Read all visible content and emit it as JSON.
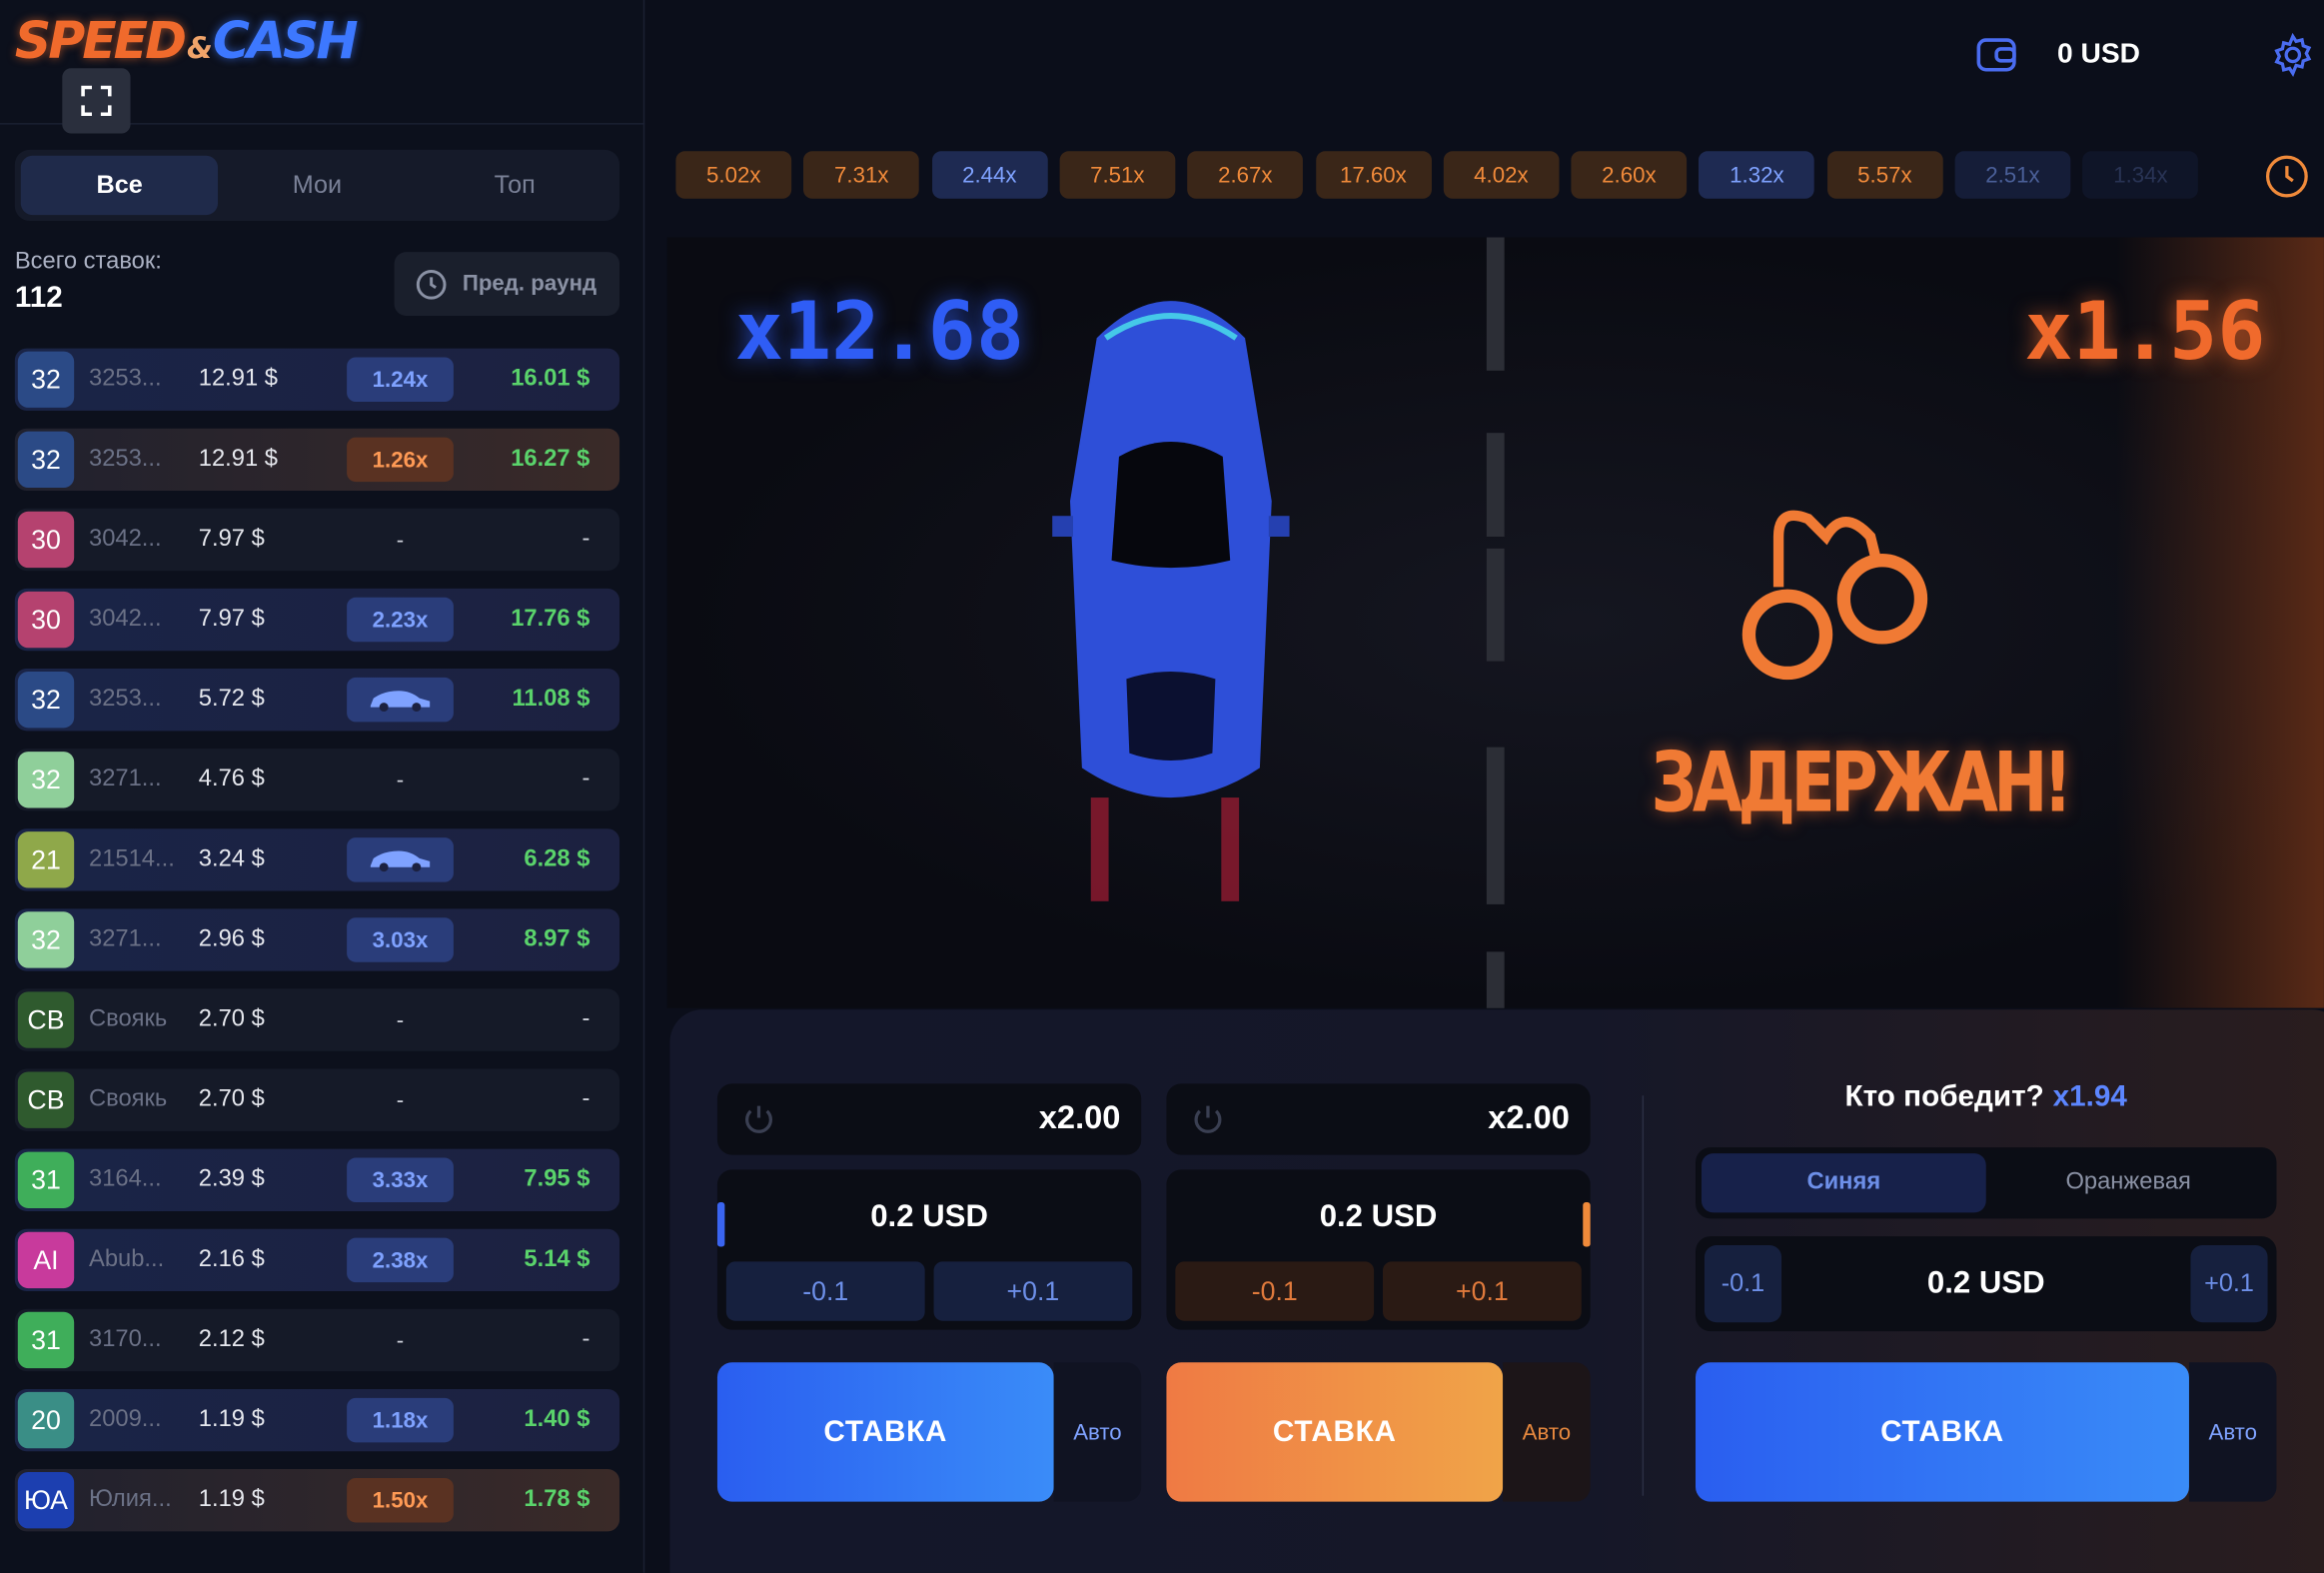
{
  "logo": {
    "part1": "SPEED",
    "amp": "&",
    "part2": "CASH"
  },
  "header": {
    "balance": "0 USD",
    "wallet_icon": "wallet-icon",
    "settings_icon": "gear-icon"
  },
  "sidebar": {
    "tabs": [
      {
        "label": "Все"
      },
      {
        "label": "Мои"
      },
      {
        "label": "Топ"
      }
    ],
    "total_label": "Всего ставок:",
    "total_value": "112",
    "prev_round_label": "Пред. раунд",
    "bets": [
      {
        "avatar": "32",
        "avatar_color": "#2b4a86",
        "name": "3253...",
        "amount": "12.91 $",
        "mult": "1.24x",
        "mult_style": "b",
        "payout": "16.01 $",
        "style": "blue"
      },
      {
        "avatar": "32",
        "avatar_color": "#2b4a86",
        "name": "3253...",
        "amount": "12.91 $",
        "mult": "1.26x",
        "mult_style": "o",
        "payout": "16.27 $",
        "style": "orange"
      },
      {
        "avatar": "30",
        "avatar_color": "#b5426f",
        "name": "3042...",
        "amount": "7.97 $",
        "mult": "-",
        "mult_style": "dash",
        "payout": "-",
        "style": "plain"
      },
      {
        "avatar": "30",
        "avatar_color": "#b5426f",
        "name": "3042...",
        "amount": "7.97 $",
        "mult": "2.23x",
        "mult_style": "b",
        "payout": "17.76 $",
        "style": "blue"
      },
      {
        "avatar": "32",
        "avatar_color": "#2b4a86",
        "name": "3253...",
        "amount": "5.72 $",
        "mult": "car",
        "mult_style": "b",
        "payout": "11.08 $",
        "style": "blue"
      },
      {
        "avatar": "32",
        "avatar_color": "#8fcf9a",
        "name": "3271...",
        "amount": "4.76 $",
        "mult": "-",
        "mult_style": "dash",
        "payout": "-",
        "style": "plain"
      },
      {
        "avatar": "21",
        "avatar_color": "#8fa84a",
        "name": "21514...",
        "amount": "3.24 $",
        "mult": "car",
        "mult_style": "b",
        "payout": "6.28 $",
        "style": "blue"
      },
      {
        "avatar": "32",
        "avatar_color": "#8fcf9a",
        "name": "3271...",
        "amount": "2.96 $",
        "mult": "3.03x",
        "mult_style": "b",
        "payout": "8.97 $",
        "style": "blue"
      },
      {
        "avatar": "СВ",
        "avatar_color": "#2f5a2e",
        "name": "Своякь",
        "amount": "2.70 $",
        "mult": "-",
        "mult_style": "dash",
        "payout": "-",
        "style": "plain"
      },
      {
        "avatar": "СВ",
        "avatar_color": "#2f5a2e",
        "name": "Своякь",
        "amount": "2.70 $",
        "mult": "-",
        "mult_style": "dash",
        "payout": "-",
        "style": "plain"
      },
      {
        "avatar": "31",
        "avatar_color": "#3fae5a",
        "name": "3164...",
        "amount": "2.39 $",
        "mult": "3.33x",
        "mult_style": "b",
        "payout": "7.95 $",
        "style": "blue"
      },
      {
        "avatar": "AI",
        "avatar_color": "#c83a9c",
        "name": "Abub...",
        "amount": "2.16 $",
        "mult": "2.38x",
        "mult_style": "b",
        "payout": "5.14 $",
        "style": "blue"
      },
      {
        "avatar": "31",
        "avatar_color": "#3fae5a",
        "name": "3170...",
        "amount": "2.12 $",
        "mult": "-",
        "mult_style": "dash",
        "payout": "-",
        "style": "plain"
      },
      {
        "avatar": "20",
        "avatar_color": "#3a8e86",
        "name": "2009...",
        "amount": "1.19 $",
        "mult": "1.18x",
        "mult_style": "b",
        "payout": "1.40 $",
        "style": "blue"
      },
      {
        "avatar": "ЮА",
        "avatar_color": "#1c3fb0",
        "name": "Юлия...",
        "amount": "1.19 $",
        "mult": "1.50x",
        "mult_style": "o",
        "payout": "1.78 $",
        "style": "orange"
      }
    ]
  },
  "history": [
    {
      "v": "5.02x",
      "c": "o"
    },
    {
      "v": "7.31x",
      "c": "o"
    },
    {
      "v": "2.44x",
      "c": "b"
    },
    {
      "v": "7.51x",
      "c": "o"
    },
    {
      "v": "2.67x",
      "c": "o"
    },
    {
      "v": "17.60x",
      "c": "o"
    },
    {
      "v": "4.02x",
      "c": "o"
    },
    {
      "v": "2.60x",
      "c": "o"
    },
    {
      "v": "1.32x",
      "c": "b"
    },
    {
      "v": "5.57x",
      "c": "o"
    },
    {
      "v": "2.51x",
      "c": "b"
    },
    {
      "v": "1.34x",
      "c": "b"
    }
  ],
  "game": {
    "blue_mult": "x12.68",
    "orange_mult": "x1.56",
    "status": "ЗАДЕРЖАН!"
  },
  "bet_panels": [
    {
      "mult": "x2.00",
      "amount": "0.2 USD",
      "minus": "-0.1",
      "plus": "+0.1",
      "stake": "СТАВКА",
      "auto": "Авто",
      "color": "b"
    },
    {
      "mult": "x2.00",
      "amount": "0.2 USD",
      "minus": "-0.1",
      "plus": "+0.1",
      "stake": "СТАВКА",
      "auto": "Авто",
      "color": "o"
    }
  ],
  "who_wins": {
    "question": "Кто победит?",
    "odds": "x1.94",
    "teams": [
      {
        "label": "Синяя"
      },
      {
        "label": "Оранжевая"
      }
    ],
    "amount": "0.2 USD",
    "minus": "-0.1",
    "plus": "+0.1",
    "stake": "СТАВКА",
    "auto": "Авто"
  }
}
